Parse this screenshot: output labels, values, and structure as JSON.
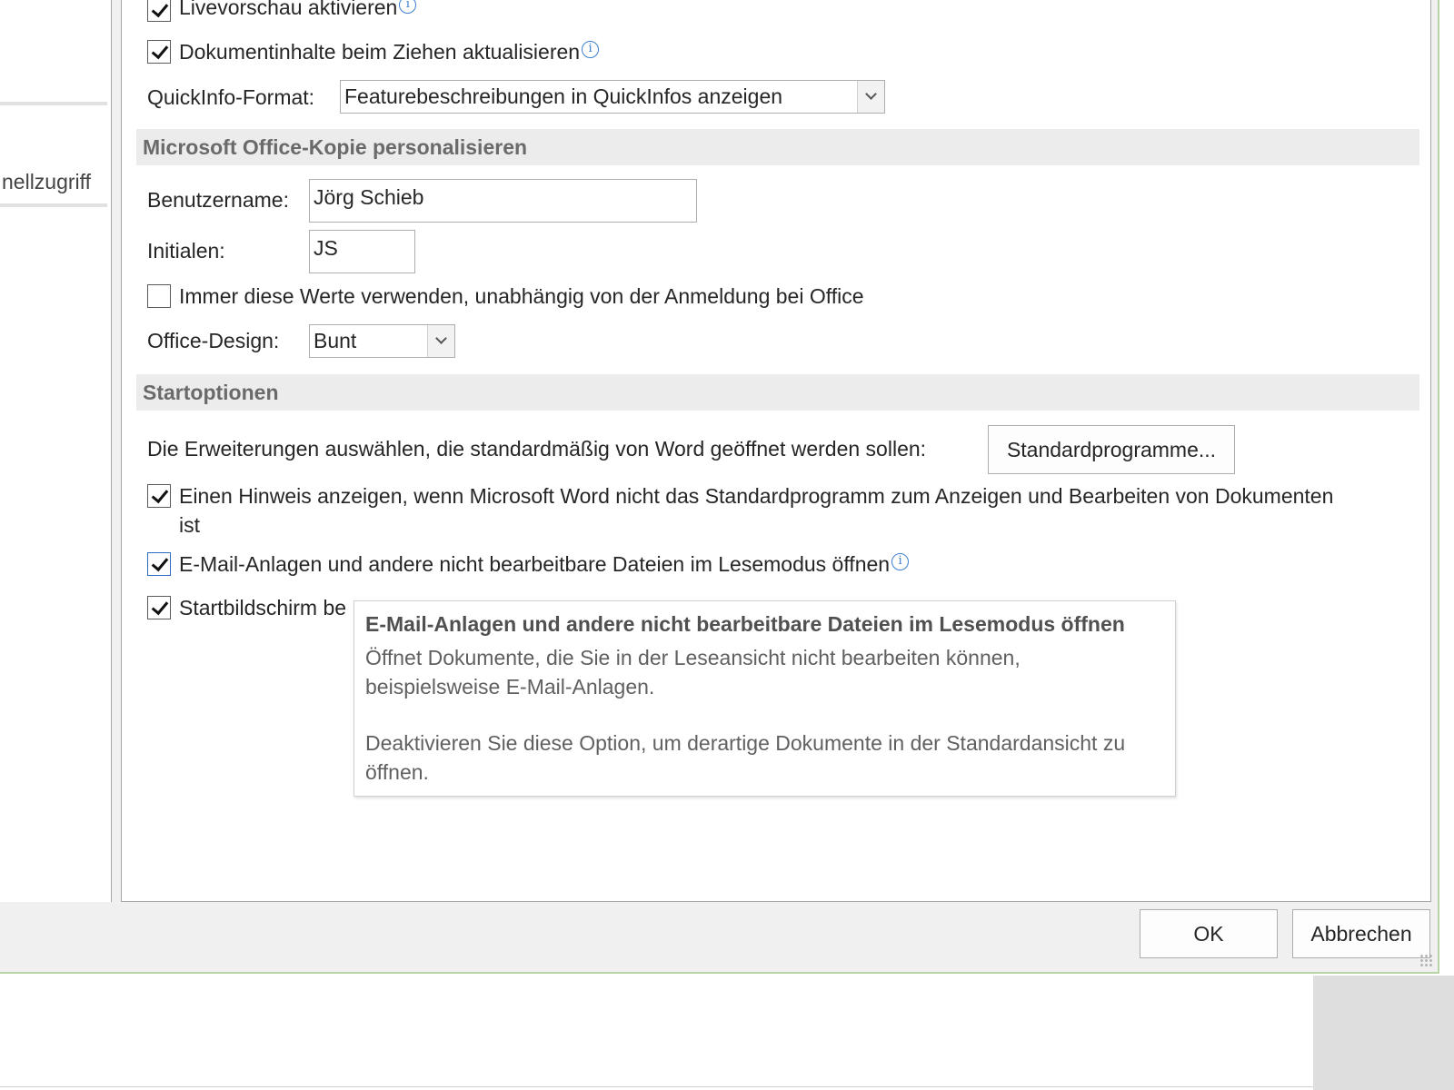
{
  "left_nav": {
    "item_partial": "nellzugriff"
  },
  "ui_options": {
    "live_preview": {
      "label": "Livevorschau aktivieren",
      "checked": true
    },
    "update_content": {
      "label": "Dokumentinhalte beim Ziehen aktualisieren",
      "checked": true
    },
    "quickinfo": {
      "label": "QuickInfo-Format:",
      "value": "Featurebeschreibungen in QuickInfos anzeigen"
    }
  },
  "personalize": {
    "header": "Microsoft Office-Kopie personalisieren",
    "username_label": "Benutzername:",
    "username_value": "Jörg Schieb",
    "initials_label": "Initialen:",
    "initials_value": "JS",
    "always_use": {
      "label": "Immer diese Werte verwenden, unabhängig von der Anmeldung bei Office",
      "checked": false
    },
    "design_label": "Office-Design:",
    "design_value": "Bunt"
  },
  "startup": {
    "header": "Startoptionen",
    "extensions_text": "Die Erweiterungen auswählen, die standardmäßig von Word geöffnet werden sollen:",
    "default_programs_button": "Standardprogramme...",
    "notify": {
      "line1": "Einen Hinweis anzeigen, wenn Microsoft Word nicht das Standardprogramm zum Anzeigen und Bearbeiten von Dokumenten",
      "line2": "ist",
      "checked": true
    },
    "reading_mode": {
      "label": "E-Mail-Anlagen und andere nicht bearbeitbare Dateien im Lesemodus öffnen",
      "checked": true
    },
    "start_screen": {
      "label": "Startbildschirm be",
      "checked": true
    }
  },
  "tooltip": {
    "title": "E-Mail-Anlagen und andere nicht bearbeitbare Dateien im Lesemodus öffnen",
    "text1_line1": "Öffnet Dokumente, die Sie in der Leseansicht nicht bearbeiten können,",
    "text1_line2": "beispielsweise E-Mail-Anlagen.",
    "text2_line1": "Deaktivieren Sie diese Option, um derartige Dokumente in der Standardansicht zu",
    "text2_line2": "öffnen."
  },
  "footer": {
    "ok": "OK",
    "cancel": "Abbrechen"
  },
  "icons": {
    "info": "i"
  }
}
